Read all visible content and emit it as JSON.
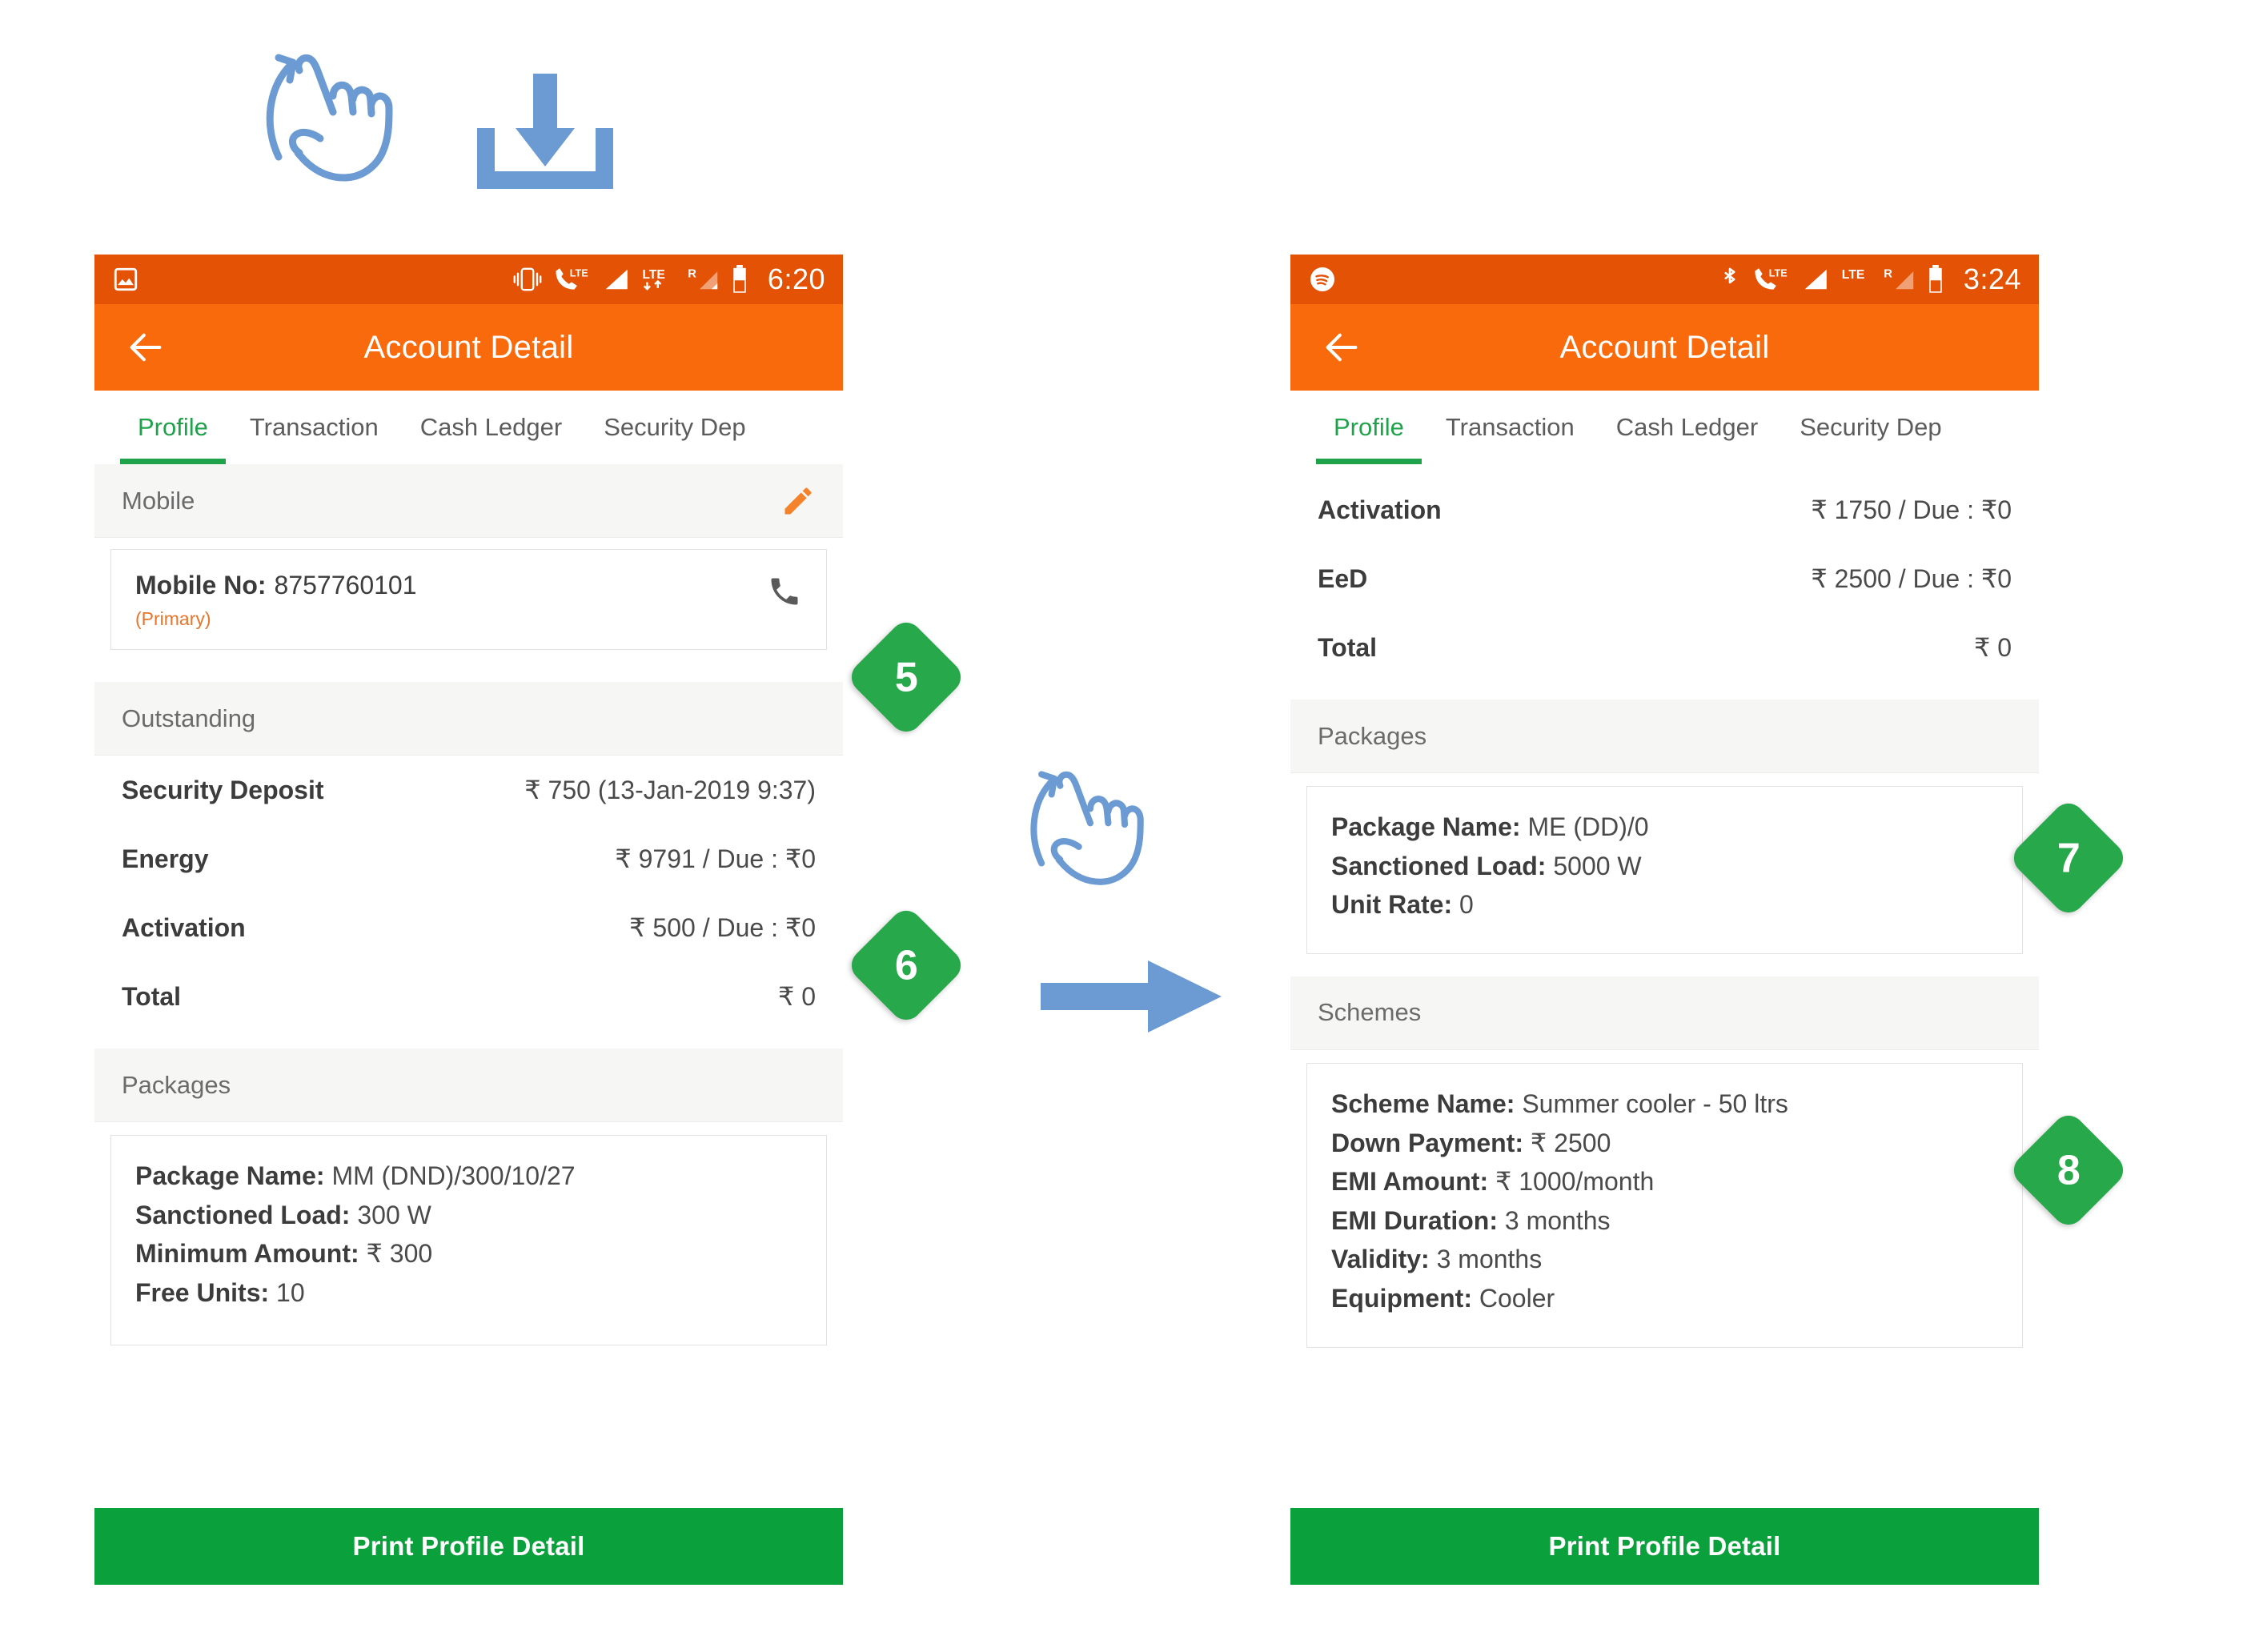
{
  "accent": {
    "status_bar_orange": "#E35205",
    "toolbar_orange": "#F96A0D",
    "tab_green": "#1FA34A",
    "badge_green": "#27A84A",
    "button_green": "#0AA03C",
    "gesture_blue": "#6B9BD2",
    "primary_orange": "#E8752A"
  },
  "screens": [
    {
      "id": "left",
      "statusbar": {
        "left_icon": "photo-icon",
        "icons": [
          "vibrate-icon",
          "lte-call-icon",
          "signal-icon",
          "lte-data-icon",
          "roaming-icon",
          "battery-icon"
        ],
        "lte_label": "LTE",
        "roaming_label": "R",
        "time": "6:20"
      },
      "toolbar": {
        "back_icon": "back-arrow-icon",
        "title": "Account Detail"
      },
      "tabs": [
        {
          "label": "Profile",
          "active": true
        },
        {
          "label": "Transaction",
          "active": false
        },
        {
          "label": "Cash Ledger",
          "active": false
        },
        {
          "label": "Security Dep",
          "active": false
        }
      ],
      "mobile_section": {
        "title": "Mobile",
        "edit_icon": "pencil-icon",
        "call_icon": "phone-icon",
        "label": "Mobile No:",
        "number": "8757760101",
        "tag": "(Primary)"
      },
      "outstanding": {
        "title": "Outstanding",
        "rows": [
          {
            "key": "Security Deposit",
            "value": "₹ 750 (13-Jan-2019 9:37)"
          },
          {
            "key": "Energy",
            "value": "₹ 9791 / Due : ₹0"
          },
          {
            "key": "Activation",
            "value": "₹ 500 / Due : ₹0"
          },
          {
            "key": "Total",
            "value": "₹ 0"
          }
        ]
      },
      "packages": {
        "title": "Packages",
        "lines": [
          {
            "label": "Package Name:",
            "value": " MM (DND)/300/10/27"
          },
          {
            "label": "Sanctioned Load:",
            "value": " 300 W"
          },
          {
            "label": "Minimum Amount:",
            "value": " ₹ 300"
          },
          {
            "label": "Free Units:",
            "value": " 10"
          }
        ]
      },
      "print_button": "Print Profile Detail"
    },
    {
      "id": "right",
      "statusbar": {
        "left_icon": "spotify-icon",
        "icons": [
          "bluetooth-icon",
          "lte-call-icon",
          "signal-icon",
          "lte-data-icon",
          "roaming-icon",
          "battery-icon"
        ],
        "lte_label": "LTE",
        "roaming_label": "R",
        "time": "3:24"
      },
      "toolbar": {
        "back_icon": "back-arrow-icon",
        "title": "Account Detail"
      },
      "tabs": [
        {
          "label": "Profile",
          "active": true
        },
        {
          "label": "Transaction",
          "active": false
        },
        {
          "label": "Cash Ledger",
          "active": false
        },
        {
          "label": "Security Dep",
          "active": false
        }
      ],
      "outstanding": {
        "rows": [
          {
            "key": "Activation",
            "value": "₹ 1750 / Due : ₹0"
          },
          {
            "key": "EeD",
            "value": "₹ 2500 / Due : ₹0"
          },
          {
            "key": "Total",
            "value": "₹ 0"
          }
        ]
      },
      "packages": {
        "title": "Packages",
        "lines": [
          {
            "label": "Package Name:",
            "value": " ME (DD)/0"
          },
          {
            "label": "Sanctioned Load:",
            "value": " 5000 W"
          },
          {
            "label": "Unit Rate:",
            "value": " 0"
          }
        ]
      },
      "schemes": {
        "title": "Schemes",
        "lines": [
          {
            "label": "Scheme Name:",
            "value": " Summer cooler - 50 ltrs"
          },
          {
            "label": "Down Payment:",
            "value": " ₹ 2500"
          },
          {
            "label": "EMI Amount:",
            "value": " ₹ 1000/month"
          },
          {
            "label": "EMI Duration:",
            "value": " 3 months"
          },
          {
            "label": "Validity:",
            "value": " 3 months"
          },
          {
            "label": "Equipment:",
            "value": " Cooler"
          }
        ]
      },
      "print_button": "Print Profile Detail"
    }
  ],
  "badges": [
    {
      "number": "5"
    },
    {
      "number": "6"
    },
    {
      "number": "7"
    },
    {
      "number": "8"
    }
  ],
  "annotations": {
    "swipe_up_hand_top": "swipe-up-hand-icon",
    "download_icon": "download-icon",
    "swipe_up_hand_middle": "swipe-up-hand-icon",
    "right_arrow": "right-arrow-icon"
  }
}
